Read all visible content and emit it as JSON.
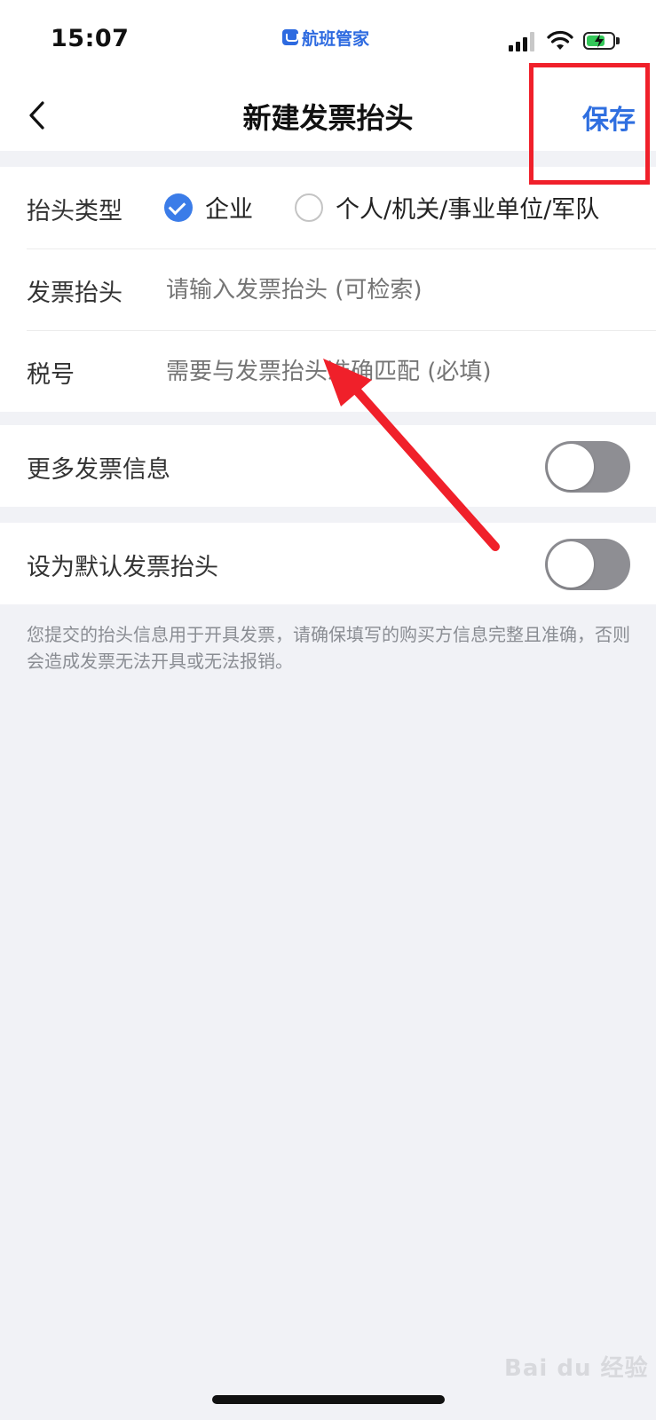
{
  "status_bar": {
    "time": "15:07",
    "app_name": "航班管家",
    "signal_icon": "cellular-signal-icon",
    "wifi_icon": "wifi-icon",
    "battery_icon": "battery-charging-icon",
    "battery_level": 0.7
  },
  "nav": {
    "back_icon": "chevron-left-icon",
    "title": "新建发票抬头",
    "save_label": "保存"
  },
  "form": {
    "type_label": "抬头类型",
    "type_options": [
      {
        "label": "企业",
        "checked": true
      },
      {
        "label": "个人/机关/事业单位/军队",
        "checked": false
      }
    ],
    "title_label": "发票抬头",
    "title_placeholder": "请输入发票抬头 (可检索)",
    "tax_label": "税号",
    "tax_placeholder": "需要与发票抬头准确匹配 (必填)"
  },
  "settings": {
    "more_info_label": "更多发票信息",
    "more_info_on": false,
    "default_label": "设为默认发票抬头",
    "default_on": false
  },
  "note": "您提交的抬头信息用于开具发票，请确保填写的购买方信息完整且准确，否则会造成发票无法开具或无法报销。",
  "watermark": "Bai du 经验",
  "colors": {
    "accent": "#2f6fe0",
    "annotation": "#f0202a",
    "background": "#f1f2f6"
  }
}
